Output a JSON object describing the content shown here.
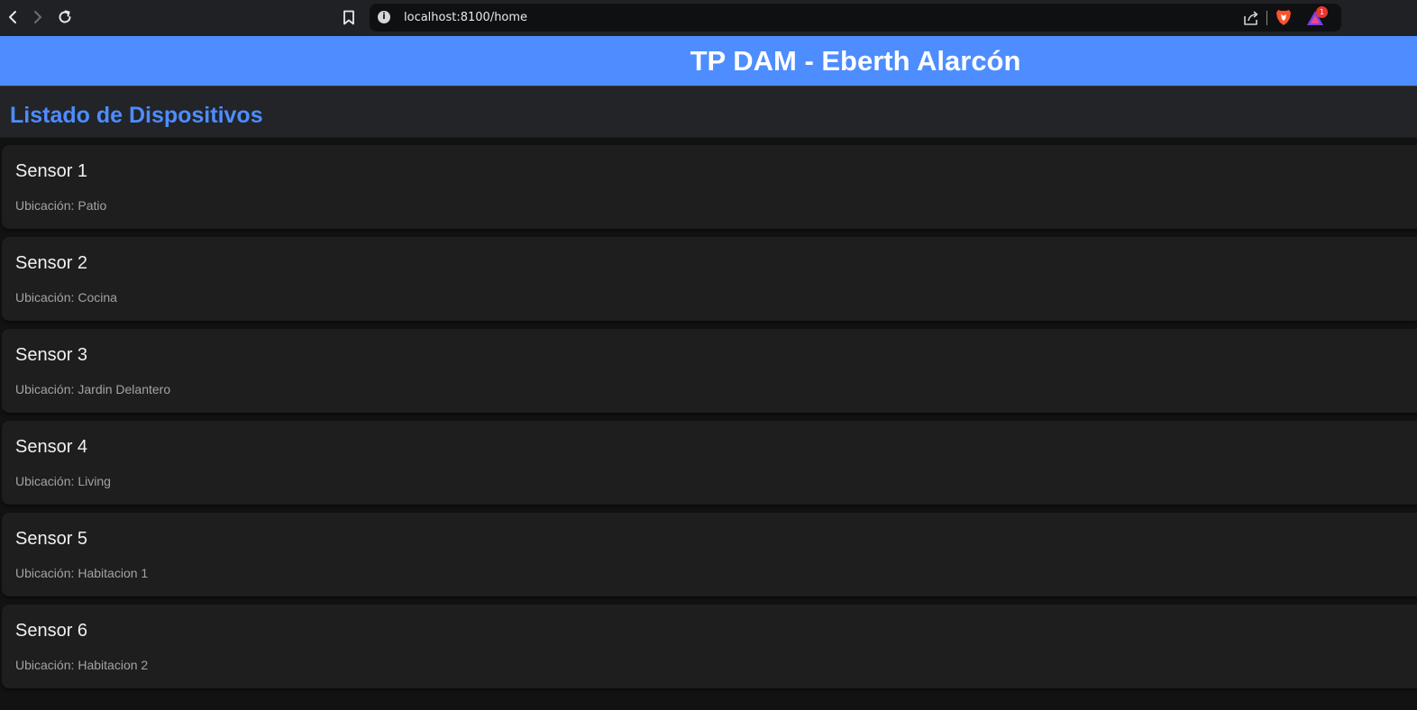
{
  "browser": {
    "url": "localhost:8100/home",
    "rewards_badge_count": "1",
    "icons": [
      "back-icon",
      "forward-icon",
      "reload-icon",
      "bookmark-icon",
      "info-icon",
      "share-icon",
      "brave-shield-icon",
      "brave-rewards-icon"
    ]
  },
  "toolbar": {
    "title": "TP DAM - Eberth Alarcón",
    "background_color": "#4d8dff"
  },
  "section": {
    "title": "Listado de Dispositivos",
    "title_color": "#4d8dff"
  },
  "location_label": "Ubicación:",
  "devices": [
    {
      "name": "Sensor 1",
      "location": "Patio"
    },
    {
      "name": "Sensor 2",
      "location": "Cocina"
    },
    {
      "name": "Sensor 3",
      "location": "Jardin Delantero"
    },
    {
      "name": "Sensor 4",
      "location": "Living"
    },
    {
      "name": "Sensor 5",
      "location": "Habitacion 1"
    },
    {
      "name": "Sensor 6",
      "location": "Habitacion 2"
    }
  ]
}
